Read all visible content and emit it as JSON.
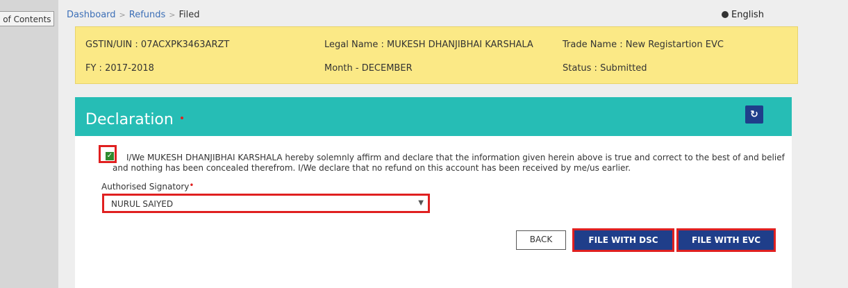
{
  "toc_tab": "e of Contents",
  "breadcrumb": {
    "dashboard": "Dashboard",
    "refunds": "Refunds",
    "current": "Filed",
    "separator": ">"
  },
  "language": "English",
  "info": {
    "gstin": "GSTIN/UIN : 07ACXPK3463ARZT",
    "legal_name": "Legal Name : MUKESH DHANJIBHAI KARSHALA",
    "trade_name": "Trade Name : New Registartion EVC",
    "fy": "FY : 2017-2018",
    "month": "Month - DECEMBER",
    "status": "Status : Submitted"
  },
  "declaration": {
    "title": "Declaration",
    "required_marker": "•",
    "checked": true,
    "text": "I/We MUKESH DHANJIBHAI KARSHALA hereby solemnly affirm and declare that the information given herein above is true and correct to the best of and belief and nothing has been concealed therefrom. I/We declare that no refund on this account has been received by me/us earlier.",
    "signatory_label": "Authorised Signatory",
    "signatory_required": "•",
    "signatory_value": "NURUL SAIYED"
  },
  "buttons": {
    "back": "BACK",
    "file_dsc": "FILE WITH DSC",
    "file_evc": "FILE WITH EVC"
  },
  "colors": {
    "header_teal": "#26bdb5",
    "info_yellow": "#fbe986",
    "button_navy": "#1f3e8a",
    "highlight_red": "#e02020"
  }
}
